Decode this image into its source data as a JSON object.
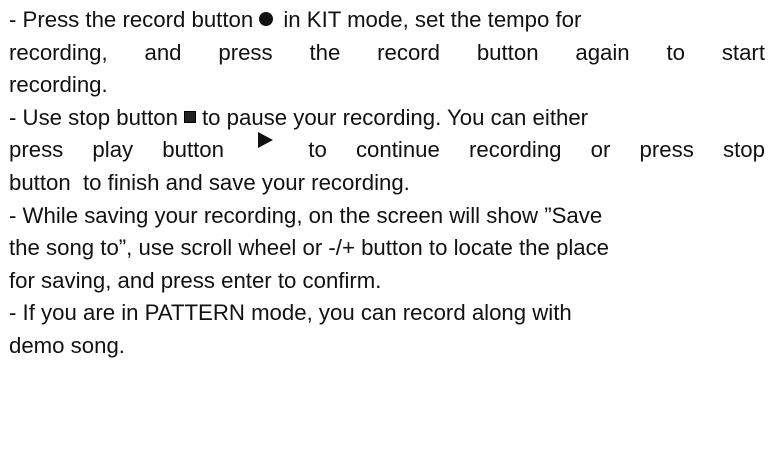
{
  "paragraphs": [
    {
      "l1_a": "- Press the record button",
      "l1_b": "in KIT mode, set the tempo for",
      "l2_words": [
        "recording,",
        "and",
        "press",
        "the",
        "record",
        "button",
        "again",
        "to",
        "start"
      ],
      "l3": "recording."
    },
    {
      "l1_a": "- Use stop button",
      "l1_b": "to pause your recording. You can either",
      "l2_words": [
        "press",
        "play",
        "button",
        "▶",
        "to",
        "continue",
        "recording",
        "or",
        "press",
        "stop"
      ],
      "l3": "button  to finish and save your recording."
    },
    {
      "l1": "- While saving your recording, on the screen will show ”Save",
      "l2": "the song to”, use scroll wheel or -/+ button to locate the place",
      "l3": "for saving, and press enter to confirm."
    },
    {
      "l1": "- If you are in PATTERN mode, you can record along with",
      "l2": "demo song."
    }
  ],
  "icons": {
    "record": "record-icon",
    "stop": "stop-icon",
    "play": "play-icon"
  }
}
